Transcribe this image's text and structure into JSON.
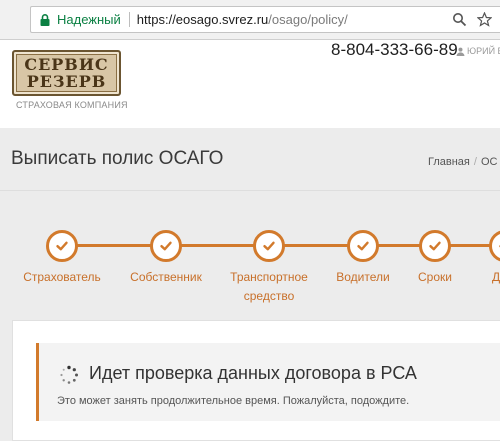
{
  "browser": {
    "secure_label": "Надежный",
    "url_host": "https://eosago.svrez.ru",
    "url_path": "/osago/policy/",
    "icons": [
      "lock-icon",
      "search-icon",
      "star-icon"
    ]
  },
  "header": {
    "logo_line1": "СЕРВИС",
    "logo_line2": "РЕЗЕРВ",
    "logo_caption": "СТРАХОВАЯ КОМПАНИЯ",
    "phone": "8-804-333-66-89",
    "account_label": "ЮРИЙ ВЕ"
  },
  "page": {
    "title": "Выписать полис ОСАГО",
    "breadcrumb": [
      "Главная",
      "ОС"
    ]
  },
  "steps": [
    {
      "label": "Страхователь",
      "status": "done"
    },
    {
      "label": "Собственник",
      "status": "done"
    },
    {
      "label": "Транспортное\nсредство",
      "status": "done"
    },
    {
      "label": "Водители",
      "status": "done"
    },
    {
      "label": "Сроки",
      "status": "done"
    },
    {
      "label": "Дос",
      "status": "done"
    }
  ],
  "check": {
    "title": "Идет проверка данных договора в РСА",
    "message": "Это может занять продолжительное время. Пожалуйста, подождите."
  },
  "colors": {
    "accent": "#d27a2c",
    "secure": "#0b8043",
    "background": "#ececec"
  }
}
